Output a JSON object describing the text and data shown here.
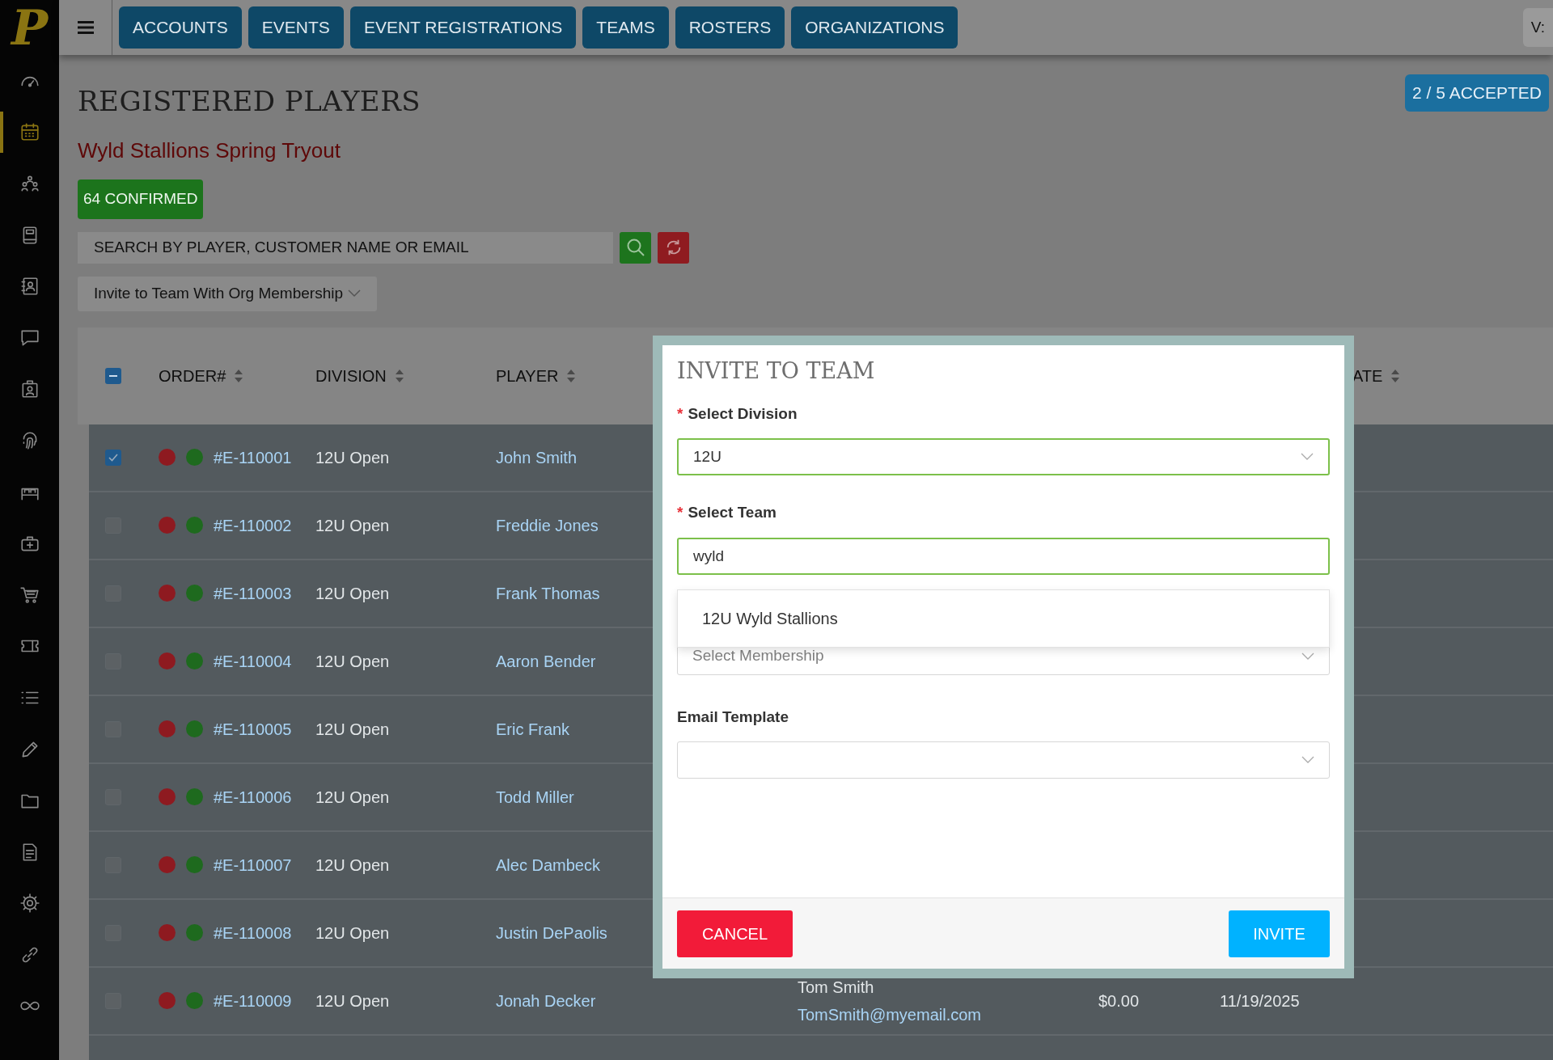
{
  "logo": "P",
  "sidebar": {
    "items": [
      {
        "selected": false
      },
      {
        "selected": true
      },
      {
        "selected": false
      },
      {
        "selected": false
      },
      {
        "selected": false
      },
      {
        "selected": false
      },
      {
        "selected": false
      },
      {
        "selected": false
      },
      {
        "selected": false
      },
      {
        "selected": false
      },
      {
        "selected": false
      },
      {
        "selected": false
      },
      {
        "selected": false
      },
      {
        "selected": false
      },
      {
        "selected": false
      },
      {
        "selected": false
      },
      {
        "selected": false
      },
      {
        "selected": false
      },
      {
        "selected": false
      }
    ]
  },
  "nav_tabs": [
    "ACCOUNTS",
    "EVENTS",
    "EVENT REGISTRATIONS",
    "TEAMS",
    "ROSTERS",
    "ORGANIZATIONS"
  ],
  "version": "V:",
  "page_title": "REGISTERED PLAYERS",
  "accepted": "2 / 5 ACCEPTED",
  "event_name": "Wyld Stallions Spring Tryout",
  "confirmed": "64 CONFIRMED",
  "search": {
    "placeholder": "SEARCH BY PLAYER, CUSTOMER NAME OR EMAIL"
  },
  "action_select": "Invite to Team With Org Membership",
  "table": {
    "select_all": {
      "indeterminate": true
    },
    "columns": [
      "ORDER#",
      "DIVISION",
      "PLAYER",
      "ATE"
    ],
    "rows": [
      {
        "selected": true,
        "dots": [
          {
            "color": "#8e1a20"
          },
          {
            "color": "#1e6a1e"
          }
        ],
        "order": "#E-110001",
        "division": "12U Open",
        "player": "John Smith"
      },
      {
        "selected": false,
        "dots": [
          {
            "color": "#8e1a20"
          },
          {
            "color": "#1e6a1e"
          }
        ],
        "order": "#E-110002",
        "division": "12U Open",
        "player": "Freddie Jones"
      },
      {
        "selected": false,
        "dots": [
          {
            "color": "#8e1a20"
          },
          {
            "color": "#1e6a1e"
          }
        ],
        "order": "#E-110003",
        "division": "12U Open",
        "player": "Frank Thomas"
      },
      {
        "selected": false,
        "dots": [
          {
            "color": "#8e1a20"
          },
          {
            "color": "#1e6a1e"
          }
        ],
        "order": "#E-110004",
        "division": "12U Open",
        "player": "Aaron Bender"
      },
      {
        "selected": false,
        "dots": [
          {
            "color": "#8e1a20"
          },
          {
            "color": "#1e6a1e"
          }
        ],
        "order": "#E-110005",
        "division": "12U Open",
        "player": "Eric Frank"
      },
      {
        "selected": false,
        "dots": [
          {
            "color": "#8e1a20"
          },
          {
            "color": "#1e6a1e"
          }
        ],
        "order": "#E-110006",
        "division": "12U Open",
        "player": "Todd Miller"
      },
      {
        "selected": false,
        "dots": [
          {
            "color": "#8e1a20"
          },
          {
            "color": "#1e6a1e"
          }
        ],
        "order": "#E-110007",
        "division": "12U Open",
        "player": "Alec Dambeck"
      },
      {
        "selected": false,
        "dots": [
          {
            "color": "#8e1a20"
          },
          {
            "color": "#1e6a1e"
          }
        ],
        "order": "#E-110008",
        "division": "12U Open",
        "player": "Justin DePaolis"
      },
      {
        "selected": false,
        "dots": [
          {
            "color": "#8e1a20"
          },
          {
            "color": "#1e6a1e"
          }
        ],
        "order": "#E-110009",
        "division": "12U Open",
        "player": "Jonah Decker",
        "customer": "Tom Smith",
        "email": "TomSmith@myemail.com",
        "amount": "$0.00",
        "date": "11/19/2025"
      }
    ]
  },
  "modal": {
    "title": "INVITE TO TEAM",
    "fields": [
      {
        "label": "Select Division",
        "marker": "*",
        "kind": "select",
        "value": "12U",
        "valid": true
      },
      {
        "label": "Select Team",
        "marker": "*",
        "kind": "input",
        "value": "wyld",
        "valid": true
      },
      {
        "kind": "select",
        "placeholder": "Select Membership",
        "valid": false
      },
      {
        "label": "Email Template",
        "kind": "select",
        "valid": false
      }
    ],
    "suggestions": [
      "12U Wyld Stallions"
    ],
    "cancel": "CANCEL",
    "invite": "INVITE"
  }
}
